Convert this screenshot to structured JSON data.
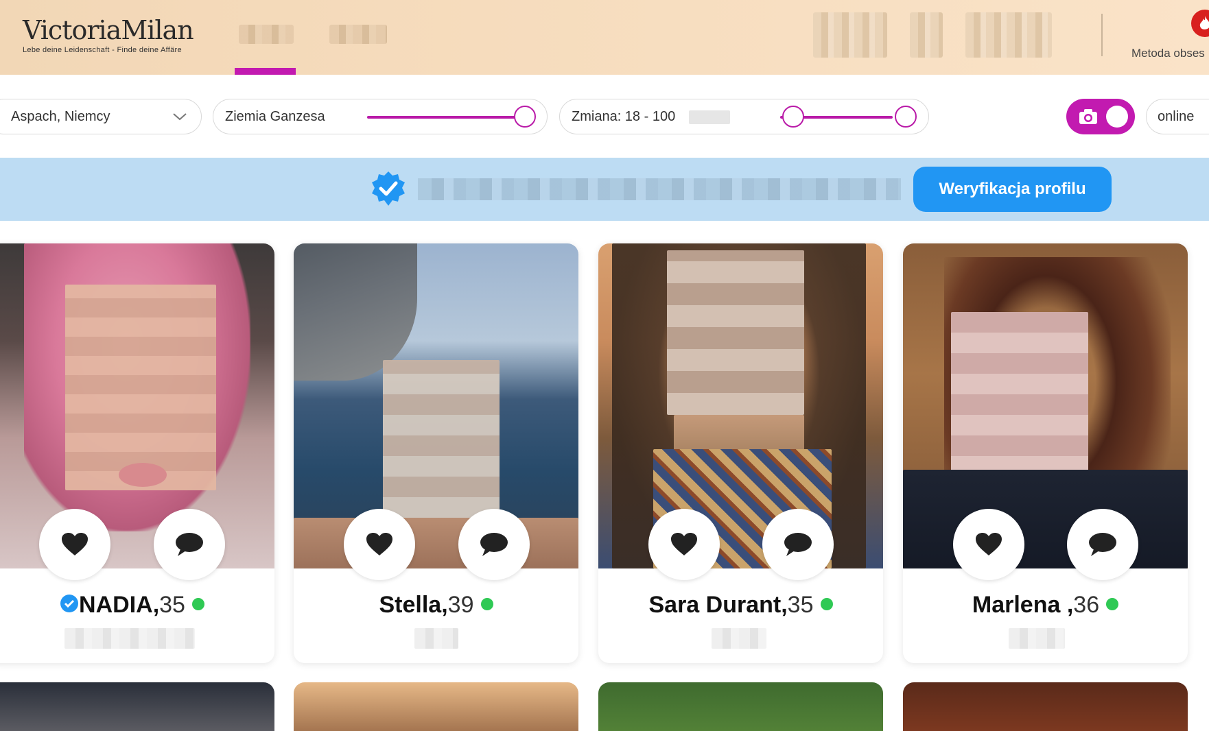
{
  "header": {
    "logo": "VictoriaMilan",
    "tagline": "Lebe deine Leidenschaft - Finde deine Affäre",
    "right_label": "Metoda obses",
    "nav_items": [
      "",
      ""
    ]
  },
  "filters": {
    "location": "Aspach, Niemcy",
    "region": "Ziemia Ganzesa",
    "age_range": "Zmiana: 18 - 100",
    "age_slider": {
      "min": 18,
      "max": 100
    },
    "region_slider": 1.0,
    "photo_toggle_on": true,
    "online": "online"
  },
  "banner": {
    "button": "Weryfikacja profilu",
    "text": ""
  },
  "profiles": [
    {
      "name": "NADIA,",
      "age": "35",
      "verified": true,
      "online": true
    },
    {
      "name": "Stella,",
      "age": "39",
      "verified": false,
      "online": true
    },
    {
      "name": "Sara Durant,",
      "age": "35",
      "verified": false,
      "online": true
    },
    {
      "name": "Marlena ,",
      "age": "36",
      "verified": false,
      "online": true
    }
  ],
  "colors": {
    "accent": "#c21ab0",
    "banner": "#bddcf3",
    "button": "#2196f3",
    "online": "#2fc954"
  }
}
